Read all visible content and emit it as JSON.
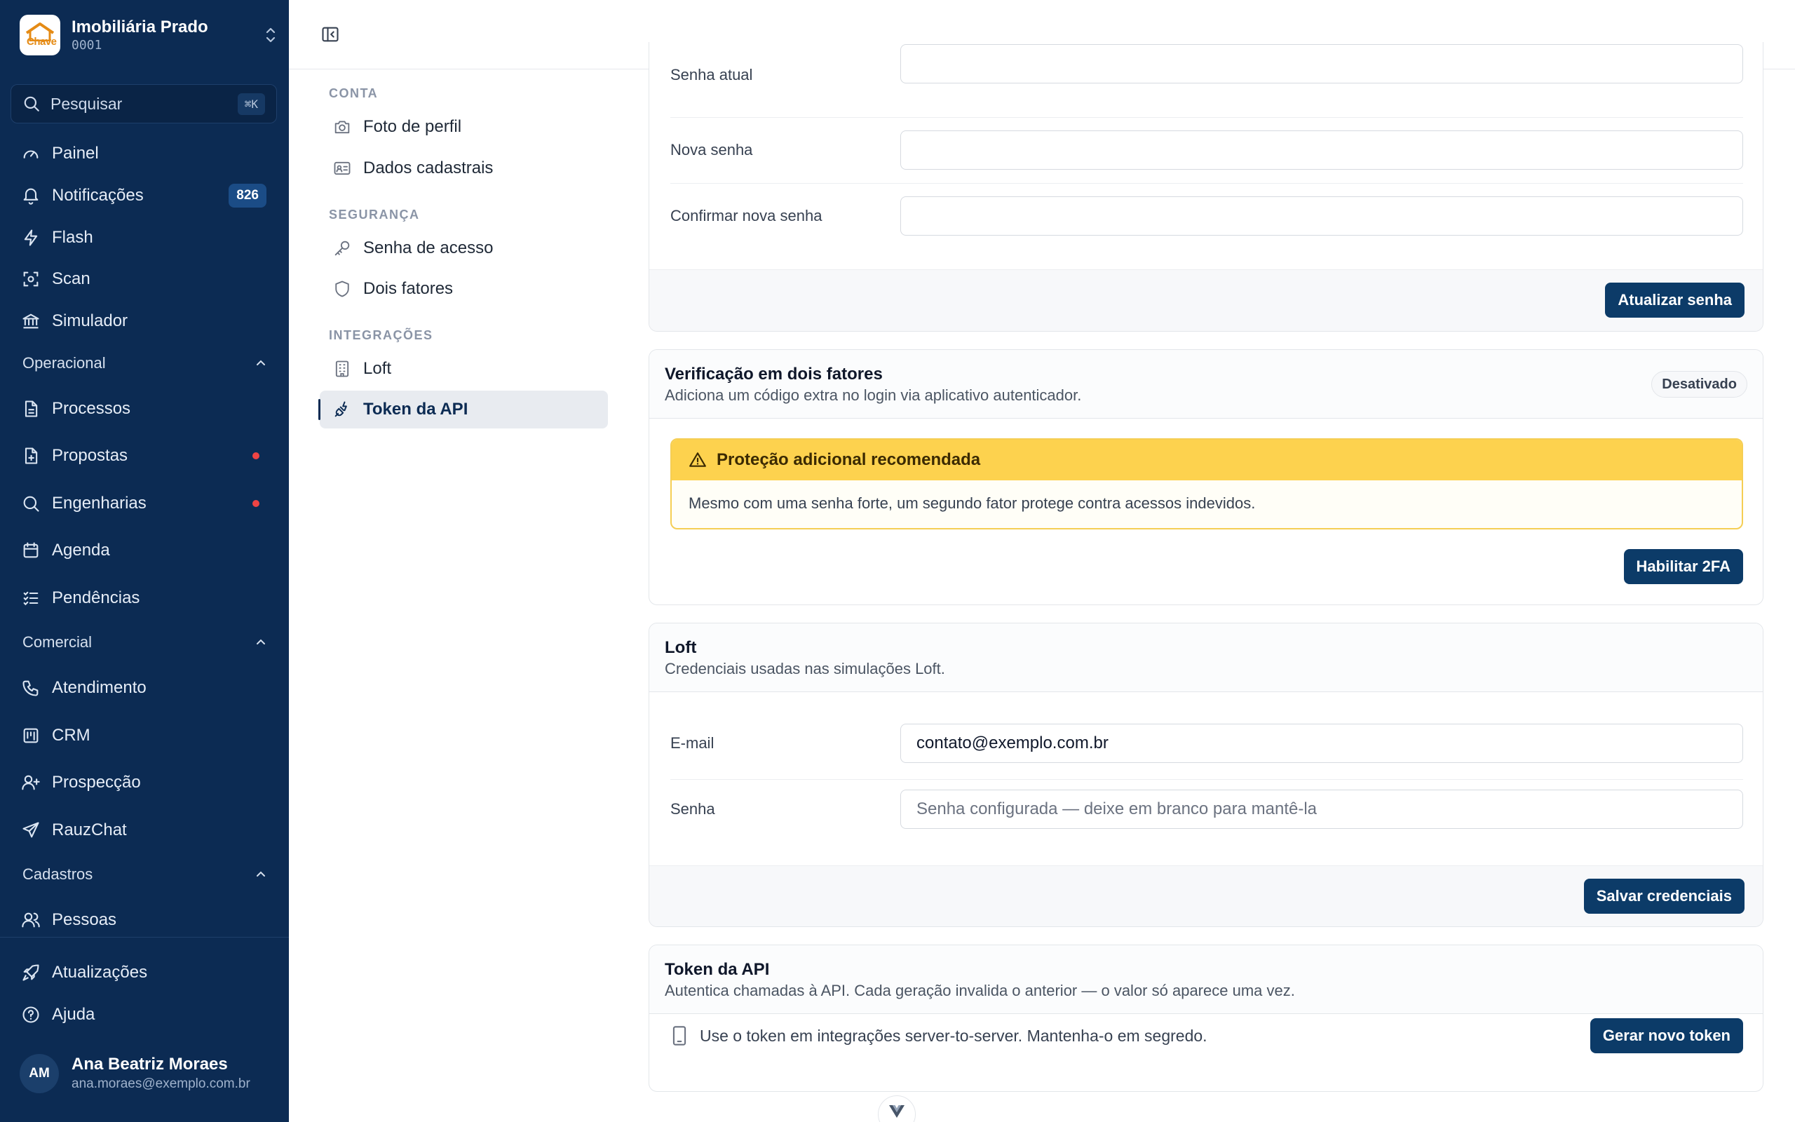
{
  "org": {
    "name": "Imobiliária Prado",
    "code": "0001",
    "logo_text": "Chave"
  },
  "search": {
    "label": "Pesquisar",
    "shortcut": "⌘K"
  },
  "sidebar": {
    "items": [
      {
        "label": "Painel",
        "icon": "gauge-icon"
      },
      {
        "label": "Notificações",
        "icon": "bell-icon",
        "badge": "826"
      },
      {
        "label": "Flash",
        "icon": "zap-icon"
      },
      {
        "label": "Scan",
        "icon": "scan-icon"
      },
      {
        "label": "Simulador",
        "icon": "bank-icon"
      }
    ],
    "groups": [
      {
        "label": "Operacional",
        "items": [
          {
            "label": "Processos",
            "icon": "file-icon"
          },
          {
            "label": "Propostas",
            "icon": "file-plus-icon",
            "dot": true
          },
          {
            "label": "Engenharias",
            "icon": "search-icon",
            "dot": true
          },
          {
            "label": "Agenda",
            "icon": "calendar-icon"
          },
          {
            "label": "Pendências",
            "icon": "list-check-icon"
          }
        ]
      },
      {
        "label": "Comercial",
        "items": [
          {
            "label": "Atendimento",
            "icon": "phone-icon"
          },
          {
            "label": "CRM",
            "icon": "kanban-icon"
          },
          {
            "label": "Prospecção",
            "icon": "user-plus-icon"
          },
          {
            "label": "RauzChat",
            "icon": "send-icon"
          }
        ]
      },
      {
        "label": "Cadastros",
        "items": [
          {
            "label": "Pessoas",
            "icon": "users-icon"
          }
        ]
      }
    ],
    "footer": [
      {
        "label": "Atualizações",
        "icon": "rocket-icon"
      },
      {
        "label": "Ajuda",
        "icon": "help-icon"
      }
    ]
  },
  "user": {
    "initials": "AM",
    "name": "Ana Beatriz Moraes",
    "email": "ana.moraes@exemplo.com.br"
  },
  "settings_nav": {
    "sections": [
      {
        "label": "CONTA",
        "items": [
          {
            "label": "Foto de perfil"
          },
          {
            "label": "Dados cadastrais"
          }
        ]
      },
      {
        "label": "SEGURANÇA",
        "items": [
          {
            "label": "Senha de acesso"
          },
          {
            "label": "Dois fatores"
          }
        ]
      },
      {
        "label": "INTEGRAÇÕES",
        "items": [
          {
            "label": "Loft"
          },
          {
            "label": "Token da API",
            "active": true
          }
        ]
      }
    ]
  },
  "password_card": {
    "fields": [
      {
        "label": "Senha atual",
        "value": ""
      },
      {
        "label": "Nova senha",
        "value": ""
      },
      {
        "label": "Confirmar nova senha",
        "value": ""
      }
    ],
    "button": "Atualizar senha"
  },
  "twofa_card": {
    "title": "Verificação em dois fatores",
    "subtitle": "Adiciona um código extra no login via aplicativo autenticador.",
    "status": "Desativado",
    "alert_title": "Proteção adicional recomendada",
    "alert_body": "Mesmo com uma senha forte, um segundo fator protege contra acessos indevidos.",
    "button": "Habilitar 2FA"
  },
  "loft_card": {
    "title": "Loft",
    "subtitle": "Credenciais usadas nas simulações Loft.",
    "email_label": "E-mail",
    "email_value": "contato@exemplo.com.br",
    "password_label": "Senha",
    "password_placeholder": "Senha configurada — deixe em branco para mantê-la",
    "button": "Salvar credenciais"
  },
  "token_card": {
    "title": "Token da API",
    "subtitle": "Autentica chamadas à API. Cada geração invalida o anterior — o valor só aparece uma vez.",
    "note": "Use o token em integrações server-to-server. Mantenha-o em segredo.",
    "button": "Gerar novo token"
  },
  "colors": {
    "sidebar_bg": "#0c2b53",
    "primary": "#0c3b68",
    "warning": "#fdd24e",
    "danger_dot": "#ef4444"
  }
}
